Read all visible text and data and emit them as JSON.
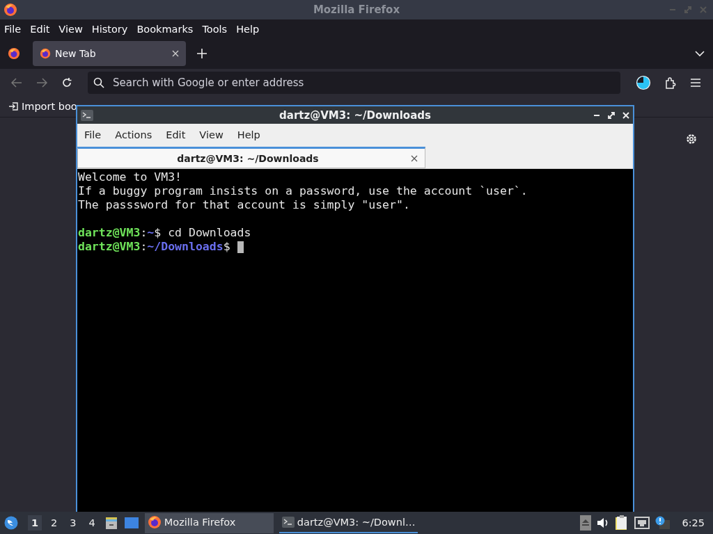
{
  "firefox": {
    "title": "Mozilla Firefox",
    "menu": [
      "File",
      "Edit",
      "View",
      "History",
      "Bookmarks",
      "Tools",
      "Help"
    ],
    "tabs": [
      {
        "label": "New Tab",
        "selected": true
      }
    ],
    "search": {
      "placeholder": "Search with Google or enter address"
    },
    "bookmarks": [
      "Import boo"
    ]
  },
  "terminal": {
    "title": "dartz@VM3: ~/Downloads",
    "menu": [
      "File",
      "Actions",
      "Edit",
      "View",
      "Help"
    ],
    "tabs": [
      {
        "label": "dartz@VM3: ~/Downloads",
        "selected": true
      }
    ],
    "lines": [
      {
        "kind": "text",
        "text": "Welcome to VM3!"
      },
      {
        "kind": "text",
        "text": "If a buggy program insists on a password, use the account `user`."
      },
      {
        "kind": "text",
        "text": "The passsword for that account is simply \"user\"."
      },
      {
        "kind": "blank"
      },
      {
        "kind": "prompt",
        "user": "dartz@VM3",
        "sep": ":",
        "path": "~",
        "symbol": "$",
        "command": "cd Downloads",
        "cursor": false
      },
      {
        "kind": "prompt",
        "user": "dartz@VM3",
        "sep": ":",
        "path": "~/Downloads",
        "symbol": "$",
        "cursor": true
      }
    ]
  },
  "taskbar": {
    "workspaces": [
      {
        "label": "1",
        "selected": true
      },
      {
        "label": "2",
        "selected": false
      },
      {
        "label": "3",
        "selected": false
      },
      {
        "label": "4",
        "selected": false
      }
    ],
    "tasks": [
      {
        "kind": "firefox",
        "label": "Mozilla Firefox",
        "selected": false
      },
      {
        "kind": "terminal",
        "label": "dartz@VM3: ~/Downl…",
        "selected": true
      }
    ],
    "clock": "6:25"
  }
}
